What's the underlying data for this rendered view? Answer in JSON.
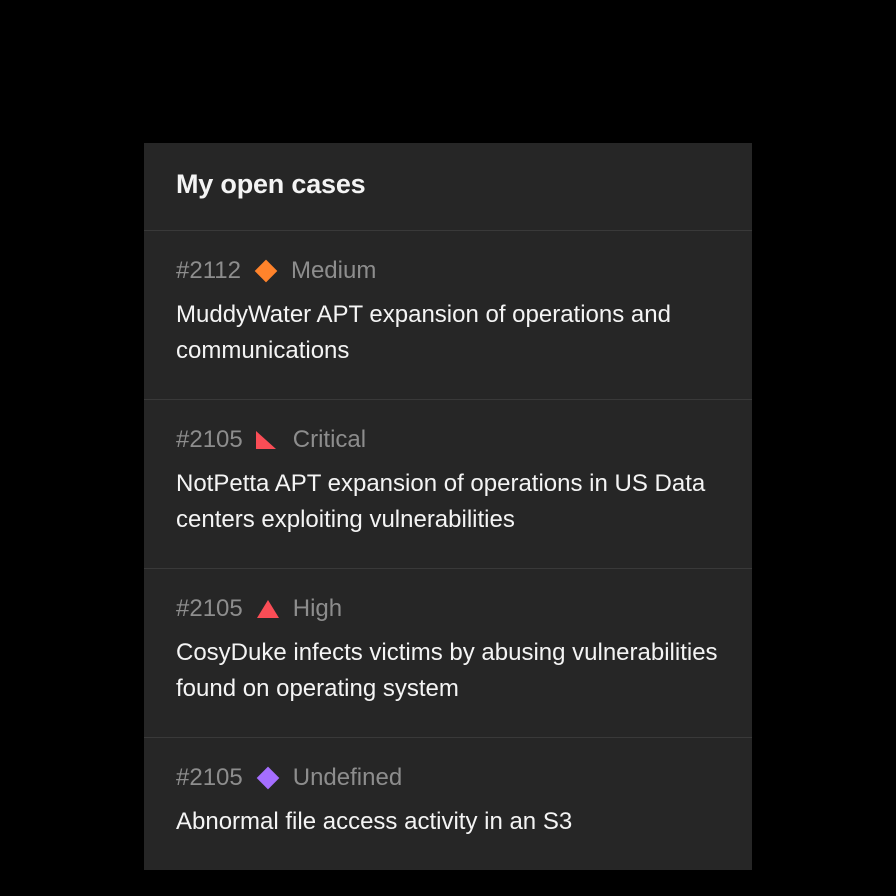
{
  "panel": {
    "title": "My open cases"
  },
  "cases": [
    {
      "id": "#2112",
      "severity": "Medium",
      "severity_icon": "diamond-orange",
      "title": "MuddyWater APT expansion of operations and communications"
    },
    {
      "id": "#2105",
      "severity": "Critical",
      "severity_icon": "triangle-right",
      "title": "NotPetta APT expansion of operations in US Data centers exploiting vulnerabilities"
    },
    {
      "id": "#2105",
      "severity": "High",
      "severity_icon": "triangle-up",
      "title": "CosyDuke infects victims by abusing vulnerabilities found on operating system"
    },
    {
      "id": "#2105",
      "severity": "Undefined",
      "severity_icon": "diamond-purple",
      "title": "Abnormal file access activity in an S3"
    }
  ]
}
